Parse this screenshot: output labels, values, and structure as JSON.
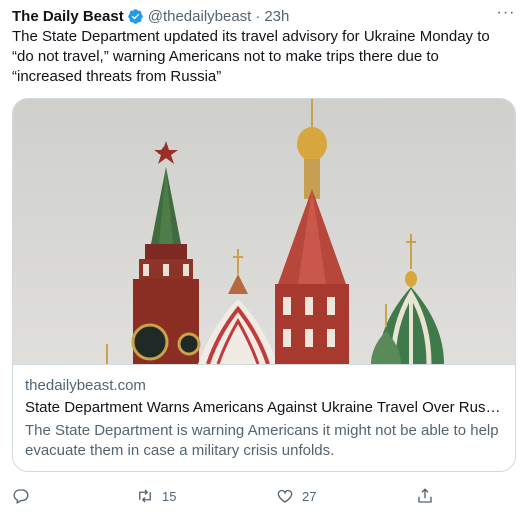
{
  "tweet": {
    "author_name": "The Daily Beast",
    "handle": "@thedailybeast",
    "separator": "·",
    "time": "23h",
    "more_label": "···",
    "text": "The State Department updated its travel advisory for Ukraine Monday to “do not travel,” warning Americans not to make trips there due to “increased threats from Russia”"
  },
  "card": {
    "domain": "thedailybeast.com",
    "title": "State Department Warns Americans Against Ukraine Travel Over Russ...",
    "description": "The State Department is warning Americans it might not be able to help evacuate them in case a military crisis unfolds."
  },
  "actions": {
    "reply_count": "",
    "retweet_count": "15",
    "like_count": "27"
  },
  "icons": {
    "verified": "verified-badge-icon",
    "reply": "reply-icon",
    "retweet": "retweet-icon",
    "like": "heart-icon",
    "share": "share-icon"
  },
  "colors": {
    "verified": "#1d9bf0",
    "secondary_text": "#536471",
    "primary_text": "#0f1419",
    "border": "#cfd9de"
  }
}
